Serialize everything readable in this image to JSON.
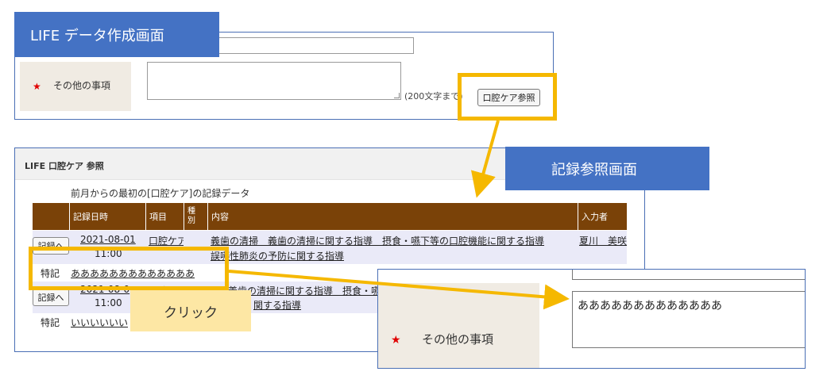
{
  "colors": {
    "accent_blue": "#4472c4",
    "highlight_yellow": "#f5b800",
    "table_header": "#7a4208",
    "label_bg": "#f0ebe3",
    "required_star": "#e00000"
  },
  "form_screen": {
    "title": "LIFE データ作成画面",
    "field_label": "その他の事項",
    "char_limit_text": "(200文字まで)",
    "oral_ref_button": "口腔ケア参照"
  },
  "ref_screen": {
    "callout": "記録参照画面",
    "header_title": "LIFE 口腔ケア 参照",
    "subtitle": "前月からの最初の[口腔ケア]の記録データ",
    "columns": [
      "記録日時",
      "項目",
      "種別",
      "内容",
      "入力者"
    ],
    "records": [
      {
        "button": "記録へ",
        "date": "2021-08-01",
        "time": "11:00",
        "item": "口腔ケア",
        "content_line1": "義歯の清掃　義歯の清掃に関する指導　摂食・嚥下等の口腔機能に関する指導",
        "content_line2": "誤嚥性肺炎の予防に関する指導",
        "author": "夏川　美咲",
        "note_label": "特記",
        "note": "あああああああああああああ"
      },
      {
        "button": "記録へ",
        "date": "2021-08-0",
        "time": "11:00",
        "item": "口腔ケ",
        "content_line1": "義歯の清掃に関する指導　摂食・嚥",
        "content_line2": "関する指導",
        "note_label": "特記",
        "note": "いいいいいい"
      }
    ]
  },
  "click_label": "クリック",
  "zoom_form": {
    "field_label": "その他の事項",
    "value": "あああああああああああああ"
  },
  "icons": {
    "required": "star-icon",
    "resize": "resize-grip-icon",
    "arrows": "arrow-icon"
  }
}
